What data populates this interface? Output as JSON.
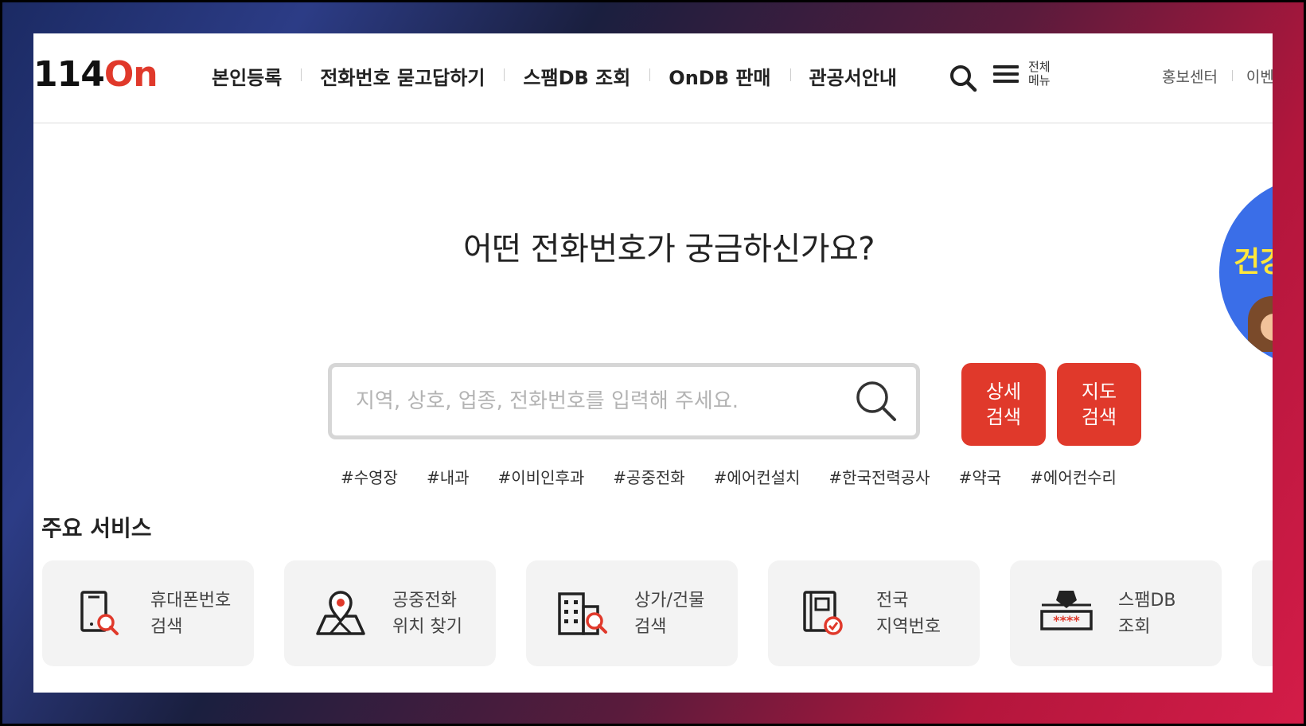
{
  "logo": {
    "num": "114",
    "on": "On"
  },
  "gnb": [
    "본인등록",
    "전화번호 묻고답하기",
    "스팸DB 조회",
    "OnDB 판매",
    "관공서안내"
  ],
  "allmenu": {
    "label_line1": "전체",
    "label_line2": "메뉴"
  },
  "util": [
    "홍보센터",
    "이벤"
  ],
  "headline": "어떤 전화번호가 궁금하신가요?",
  "search": {
    "placeholder": "지역, 상호, 업종, 전화번호를 입력해 주세요.",
    "value": ""
  },
  "buttons": {
    "detail": {
      "line1": "상세",
      "line2": "검색"
    },
    "map": {
      "line1": "지도",
      "line2": "검색"
    }
  },
  "tags": [
    "#수영장",
    "#내과",
    "#이비인후과",
    "#공중전화",
    "#에어컨설치",
    "#한국전력공사",
    "#약국",
    "#에어컨수리"
  ],
  "section_title": "주요 서비스",
  "services": [
    {
      "line1": "휴대폰번호",
      "line2": "검색",
      "icon": "mobile-search-icon"
    },
    {
      "line1": "공중전화",
      "line2": "위치 찾기",
      "icon": "map-pin-icon"
    },
    {
      "line1": "상가/건물",
      "line2": "검색",
      "icon": "building-search-icon"
    },
    {
      "line1": "전국",
      "line2": "지역번호",
      "icon": "phone-book-icon"
    },
    {
      "line1": "스팸DB",
      "line2": "조회",
      "icon": "spam-shield-icon"
    }
  ],
  "promo": {
    "text": "건강"
  },
  "colors": {
    "accent": "#e0392b",
    "promo_bg": "#3a6ee8",
    "card_bg": "#f3f3f3"
  }
}
